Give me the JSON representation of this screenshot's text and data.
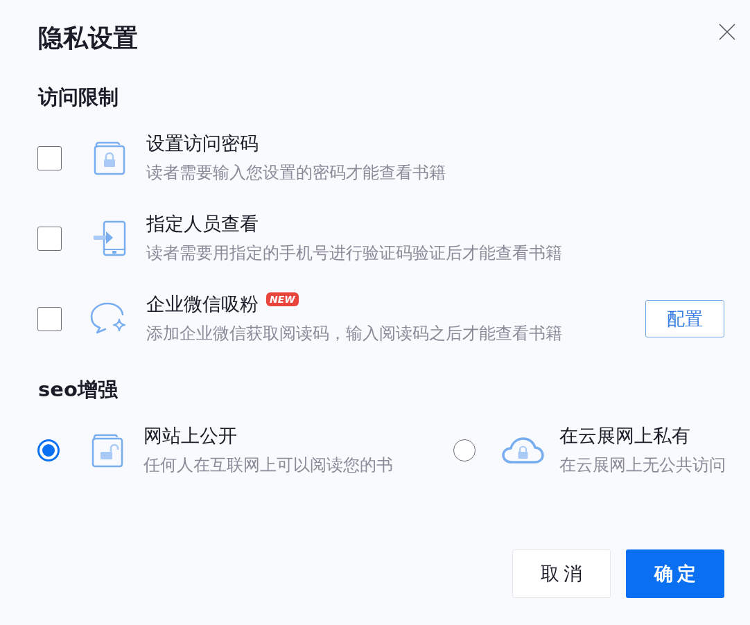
{
  "dialog": {
    "title": "隐私设置"
  },
  "access": {
    "heading": "访问限制",
    "options": [
      {
        "title": "设置访问密码",
        "description": "读者需要输入您设置的密码才能查看书籍",
        "checked": false
      },
      {
        "title": "指定人员查看",
        "description": "读者需要用指定的手机号进行验证码验证后才能查看书籍",
        "checked": false
      },
      {
        "title": "企业微信吸粉",
        "badge": "NEW",
        "description": "添加企业微信获取阅读码，输入阅读码之后才能查看书籍",
        "checked": false,
        "action": "配置"
      }
    ]
  },
  "seo": {
    "heading": "seo增强",
    "options": [
      {
        "title": "网站上公开",
        "description": "任何人在互联网上可以阅读您的书",
        "selected": true
      },
      {
        "title": "在云展网上私有",
        "description": "在云展网上无公共访问",
        "selected": false
      }
    ]
  },
  "buttons": [
    {
      "label": "取消",
      "kind": "secondary"
    },
    {
      "label": "确定",
      "kind": "primary"
    }
  ]
}
